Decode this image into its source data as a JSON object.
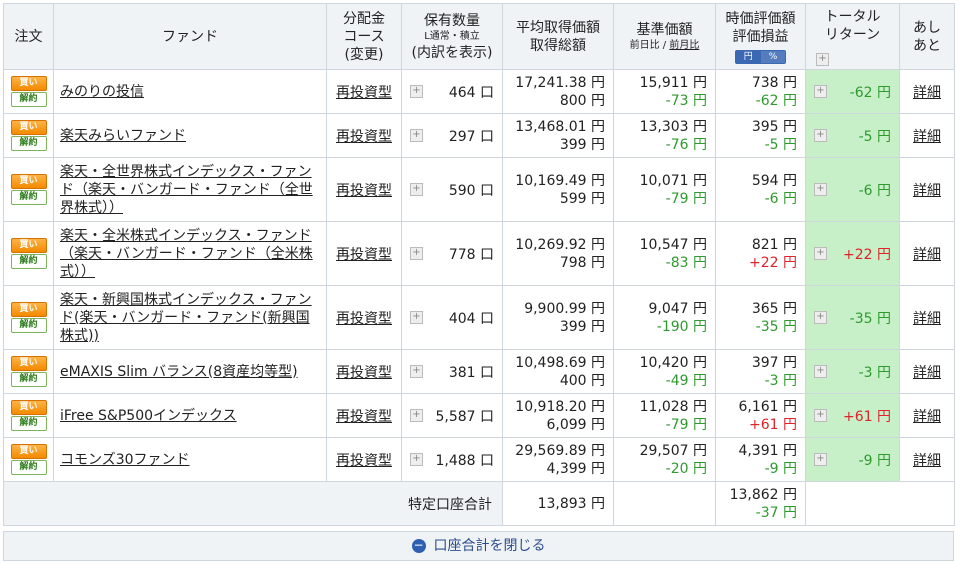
{
  "header": {
    "order": "注文",
    "fund": "ファンド",
    "course_l1": "分配金",
    "course_l2": "コース",
    "course_l3": "(変更)",
    "qty_l1": "保有数量",
    "qty_l2": "L通常・積立",
    "qty_l3": "(内訳を表示)",
    "avg_l1": "平均取得価額",
    "avg_l2": "取得総額",
    "base_l1": "基準価額",
    "base_l2a": "前日比",
    "base_l2sep": " / ",
    "base_l2b": "前月比",
    "val_l1": "時価評価額",
    "val_l2": "評価損益",
    "toggle_yen": "円",
    "toggle_pct": "%",
    "ret_l1": "トータル",
    "ret_l2": "リターン",
    "detail_l1": "あし",
    "detail_l2": "あと"
  },
  "labels": {
    "buy": "買い",
    "sell": "解約",
    "detail": "詳細"
  },
  "rows": [
    {
      "fund": "みのりの投信",
      "course": "再投資型",
      "qty": "464 口",
      "avg": "17,241.38 円",
      "total": "800 円",
      "base": "15,911 円",
      "diff": "-73 円",
      "value": "738 円",
      "pl": "-62 円",
      "ret": "-62 円"
    },
    {
      "fund": "楽天みらいファンド",
      "course": "再投資型",
      "qty": "297 口",
      "avg": "13,468.01 円",
      "total": "399 円",
      "base": "13,303 円",
      "diff": "-76 円",
      "value": "395 円",
      "pl": "-5 円",
      "ret": "-5 円"
    },
    {
      "fund": "楽天・全世界株式インデックス・ファンド（楽天・バンガード・ファンド（全世界株式））",
      "course": "再投資型",
      "qty": "590 口",
      "avg": "10,169.49 円",
      "total": "599 円",
      "base": "10,071 円",
      "diff": "-79 円",
      "value": "594 円",
      "pl": "-6 円",
      "ret": "-6 円"
    },
    {
      "fund": "楽天・全米株式インデックス・ファンド（楽天・バンガード・ファンド（全米株式））",
      "course": "再投資型",
      "qty": "778 口",
      "avg": "10,269.92 円",
      "total": "798 円",
      "base": "10,547 円",
      "diff": "-83 円",
      "value": "821 円",
      "pl": "+22 円",
      "ret": "+22 円"
    },
    {
      "fund": "楽天・新興国株式インデックス・ファンド(楽天・バンガード・ファンド(新興国株式))",
      "course": "再投資型",
      "qty": "404 口",
      "avg": "9,900.99 円",
      "total": "399 円",
      "base": "9,047 円",
      "diff": "-190 円",
      "value": "365 円",
      "pl": "-35 円",
      "ret": "-35 円"
    },
    {
      "fund": "eMAXIS Slim バランス(8資産均等型)",
      "course": "再投資型",
      "qty": "381 口",
      "avg": "10,498.69 円",
      "total": "400 円",
      "base": "10,420 円",
      "diff": "-49 円",
      "value": "397 円",
      "pl": "-3 円",
      "ret": "-3 円"
    },
    {
      "fund": "iFree S&P500インデックス",
      "course": "再投資型",
      "qty": "5,587 口",
      "avg": "10,918.20 円",
      "total": "6,099 円",
      "base": "11,028 円",
      "diff": "-79 円",
      "value": "6,161 円",
      "pl": "+61 円",
      "ret": "+61 円"
    },
    {
      "fund": "コモンズ30ファンド",
      "course": "再投資型",
      "qty": "1,488 口",
      "avg": "29,569.89 円",
      "total": "4,399 円",
      "base": "29,507 円",
      "diff": "-20 円",
      "value": "4,391 円",
      "pl": "-9 円",
      "ret": "-9 円"
    }
  ],
  "summary": {
    "label": "特定口座合計",
    "total": "13,893 円",
    "value": "13,862 円",
    "pl": "-37 円"
  },
  "footer": {
    "close_label": "口座合計を閉じる"
  },
  "colors": {
    "negative": "#2e9a2e",
    "positive": "#e0222a",
    "return_bg": "#c8f0c8",
    "header_bg": "#f0f3f6"
  }
}
